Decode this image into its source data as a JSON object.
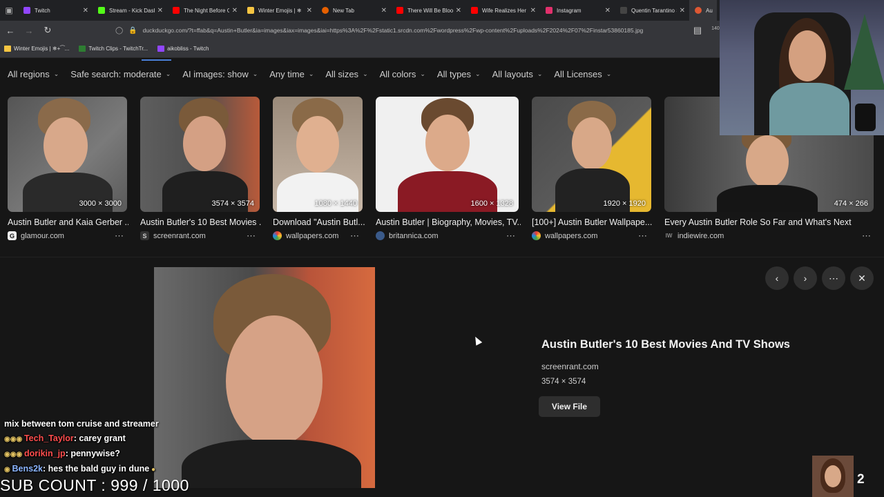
{
  "browser": {
    "tabs": [
      {
        "label": "Twitch",
        "color": "#9146ff"
      },
      {
        "label": "Stream - Kick Dashb",
        "color": "#53fc18"
      },
      {
        "label": "The Night Before Ch",
        "color": "#ff0000"
      },
      {
        "label": "Winter Emojis | ❄",
        "color": "#f5c542"
      },
      {
        "label": "New Tab",
        "color": "#e66000"
      },
      {
        "label": "There Will Be Blood",
        "color": "#ff0000"
      },
      {
        "label": "Wife Realizes Her H",
        "color": "#ff0000"
      },
      {
        "label": "Instagram",
        "color": "#e1306c"
      },
      {
        "label": "Quentin Tarantino S",
        "color": "#444444"
      },
      {
        "label": "Austin",
        "color": "#de5833"
      }
    ],
    "url": "duckduckgo.com/?t=ffab&q=Austin+Butler&ia=images&iax=images&iai=https%3A%2F%2Fstatic1.srcdn.com%2Fwordpress%2Fwp-content%2Fuploads%2F2024%2F07%2Finstar53860185.jpg",
    "zoom": "140%",
    "bookmarks": [
      {
        "label": "Winter Emojis | ❄+⁀..."
      },
      {
        "label": "Twitch Clips - TwitchTr..."
      },
      {
        "label": "aikobliss - Twitch"
      }
    ]
  },
  "filters": [
    "All regions",
    "Safe search: moderate",
    "AI images: show",
    "Any time",
    "All sizes",
    "All colors",
    "All types",
    "All layouts",
    "All Licenses"
  ],
  "results": [
    {
      "title": "Austin Butler and Kaia Gerber ...",
      "source": "glamour.com",
      "dims": "3000 × 3000",
      "icon": "G"
    },
    {
      "title": "Austin Butler's 10 Best Movies ...",
      "source": "screenrant.com",
      "dims": "3574 × 3574",
      "icon": "S"
    },
    {
      "title": "Download \"Austin Butl...",
      "source": "wallpapers.com",
      "dims": "1080 × 1440",
      "icon": ""
    },
    {
      "title": "Austin Butler | Biography, Movies, TV...",
      "source": "britannica.com",
      "dims": "1600 × 1328",
      "icon": ""
    },
    {
      "title": "[100+] Austin Butler Wallpape...",
      "source": "wallpapers.com",
      "dims": "1920 × 1920",
      "icon": ""
    },
    {
      "title": "Every Austin Butler Role So Far and What's Next",
      "source": "indiewire.com",
      "dims": "474 × 266",
      "icon": "IW"
    }
  ],
  "detail": {
    "title": "Austin Butler's 10 Best Movies And TV Shows",
    "source": "screenrant.com",
    "dims": "3574 × 3574",
    "view_button": "View File"
  },
  "overlay": {
    "chat": [
      {
        "user": "",
        "message": "mix between tom cruise and streamer"
      },
      {
        "user": "Tech_Taylor",
        "message": ": carey grant"
      },
      {
        "user": "dorikin_jp",
        "message": ": pennywise?"
      },
      {
        "user": "Bens2k",
        "message": ": hes the bald guy in dune"
      }
    ],
    "sub_count": "SUB COUNT : 999 / 1000",
    "cam2_badge": "2"
  }
}
